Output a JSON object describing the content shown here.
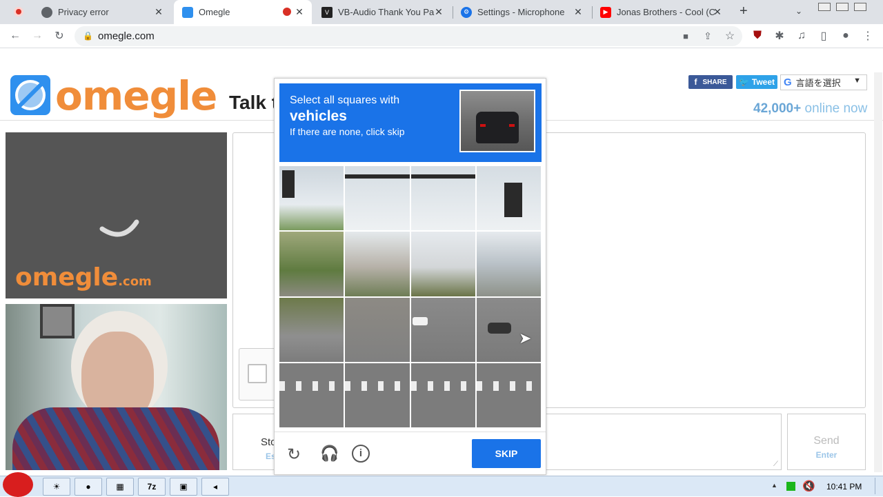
{
  "browser": {
    "tabs": [
      {
        "title": "Privacy error"
      },
      {
        "title": "Omegle"
      },
      {
        "title": "VB-Audio Thank You Pa"
      },
      {
        "title": "Settings - Microphone"
      },
      {
        "title": "Jonas Brothers - Cool (C"
      }
    ],
    "url": "omegle.com",
    "new_tab_glyph": "+"
  },
  "omegle": {
    "logo": "omegle",
    "tagline": "Talk t",
    "share_label": "SHARE",
    "tweet_label": "Tweet",
    "translate_label": "言語を選択",
    "online_count": "42,000+",
    "online_text": "online now",
    "video_logo": "omegle",
    "video_logo_suffix": ".com",
    "stop_label": "Sto",
    "esc_label": "Es",
    "send_label": "Send",
    "enter_label": "Enter"
  },
  "captcha": {
    "line1": "Select all squares with",
    "target": "vehicles",
    "line3": "If there are none, click skip",
    "skip_label": "SKIP",
    "accent": "#1a73e8"
  },
  "taskbar": {
    "clock": "10:41 PM",
    "item_7z": "7z"
  },
  "colors": {
    "omegle_orange": "#f08d3a",
    "omegle_blue": "#2f90ee"
  }
}
